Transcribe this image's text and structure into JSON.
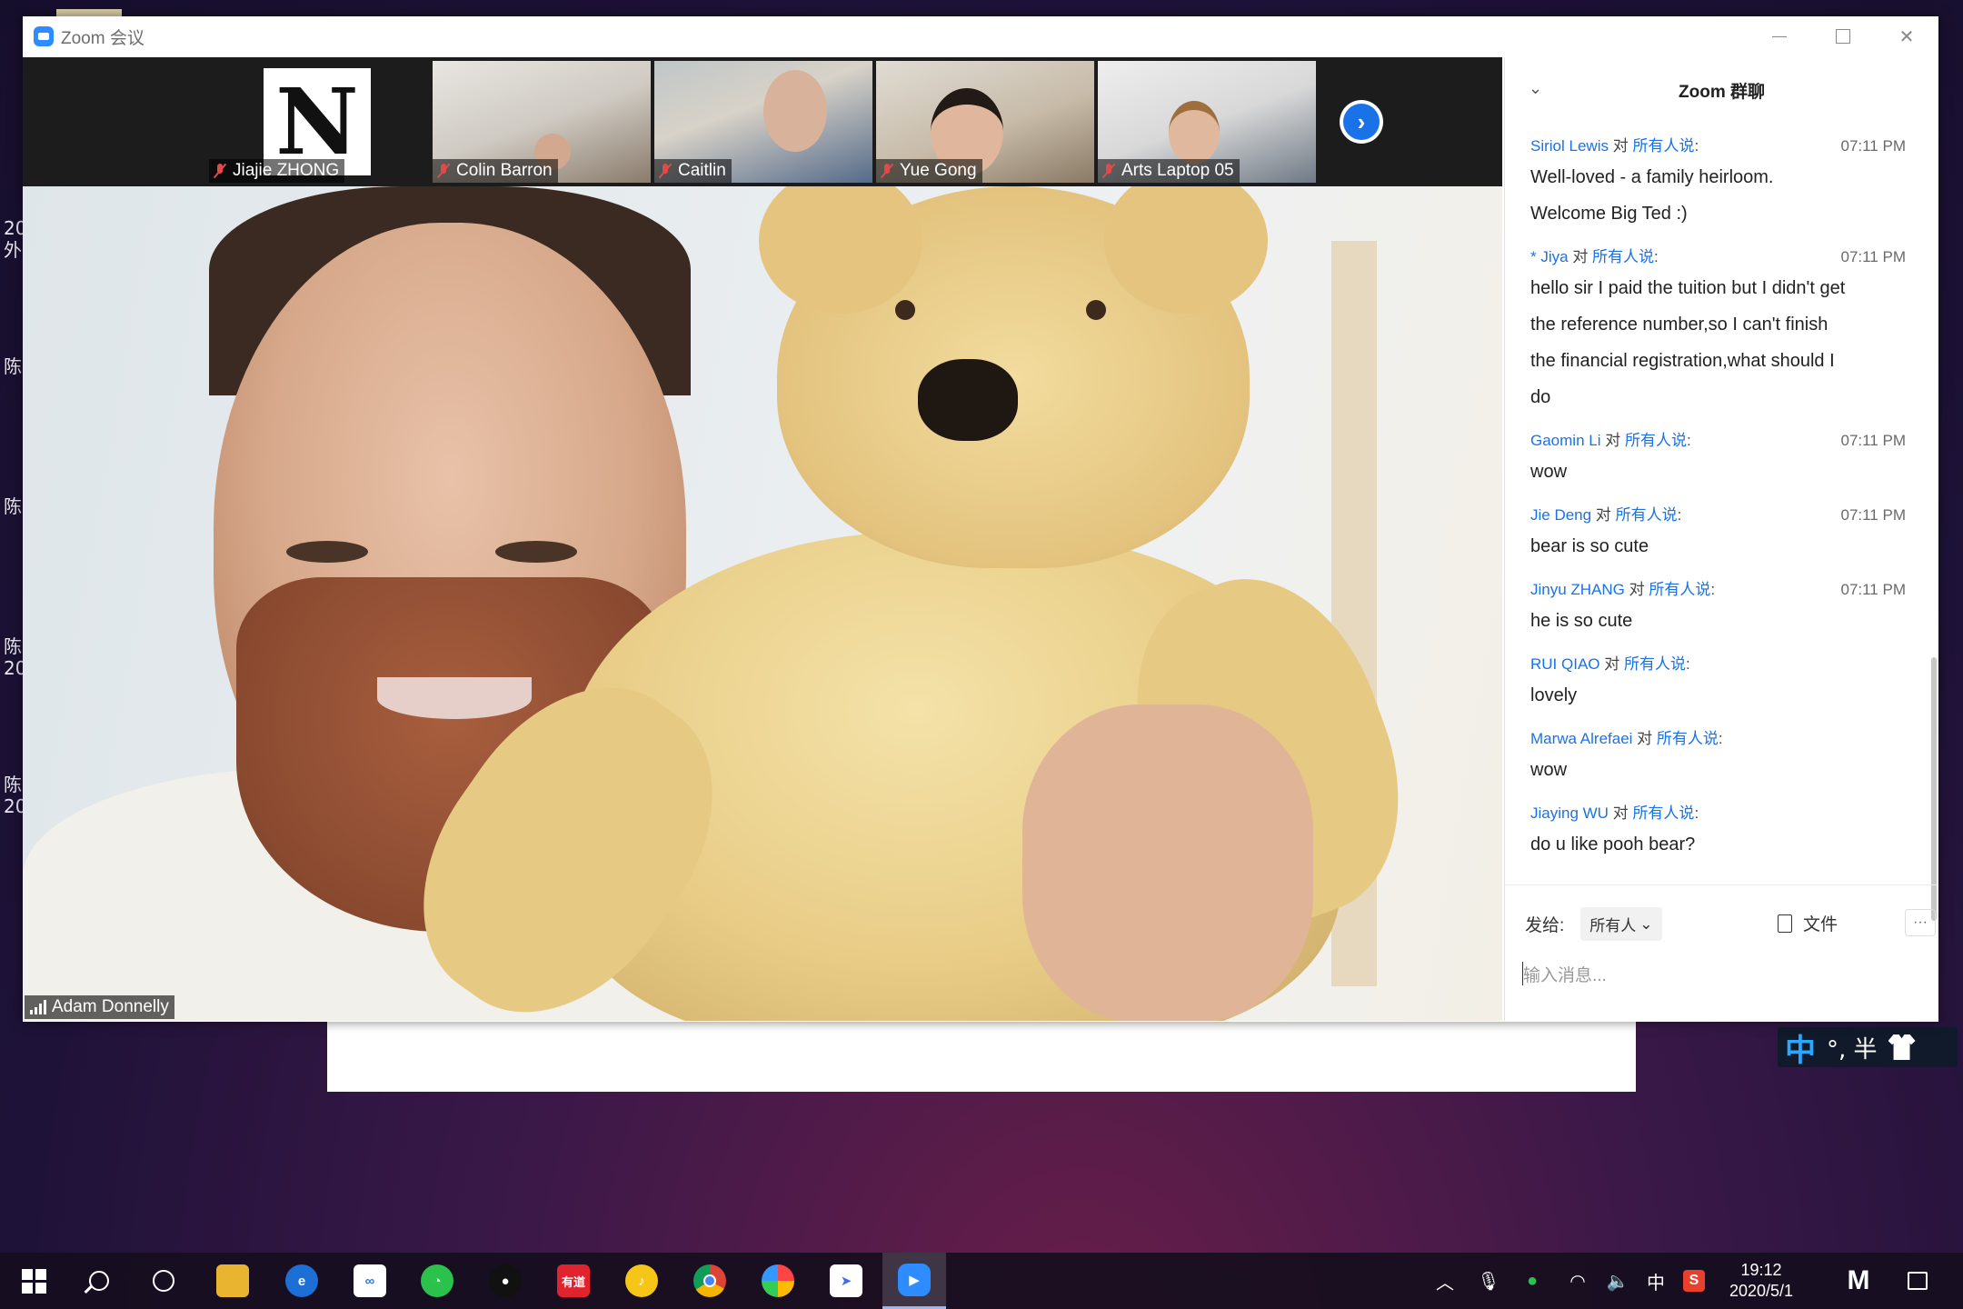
{
  "window": {
    "title": "Zoom 会议"
  },
  "desktop": {
    "side_glyphs": [
      "20",
      "外",
      "陈",
      "陈",
      "陈",
      "20",
      "陈",
      "20"
    ]
  },
  "participants": [
    {
      "name": "Jiajie ZHONG",
      "muted": true
    },
    {
      "name": "Colin Barron",
      "muted": true
    },
    {
      "name": "Caitlin",
      "muted": true
    },
    {
      "name": "Yue Gong",
      "muted": true
    },
    {
      "name": "Arts Laptop 05",
      "muted": true
    }
  ],
  "logo_tile_letter": "N",
  "active_speaker": {
    "name": "Adam Donnelly"
  },
  "chat": {
    "title": "Zoom 群聊",
    "to_word": "对",
    "target": "所有人说",
    "colon": ":",
    "messages": [
      {
        "sender": "Siriol Lewis",
        "time": "07:11 PM",
        "lines": [
          "Well-loved - a family heirloom.",
          "Welcome Big Ted :)"
        ]
      },
      {
        "sender": "* Jiya",
        "time": "07:11 PM",
        "lines": [
          "hello sir I paid the tuition but I didn't get",
          "the reference number,so I can't finish",
          "the financial registration,what should I",
          "do"
        ]
      },
      {
        "sender": "Gaomin Li",
        "time": "07:11 PM",
        "lines": [
          "wow"
        ]
      },
      {
        "sender": "Jie Deng",
        "time": "07:11 PM",
        "lines": [
          "bear is so cute"
        ]
      },
      {
        "sender": "Jinyu ZHANG",
        "time": "07:11 PM",
        "lines": [
          "he is so cute"
        ]
      },
      {
        "sender": "RUI QIAO",
        "time": "",
        "lines": [
          "lovely"
        ]
      },
      {
        "sender": "Marwa Alrefaei",
        "time": "",
        "lines": [
          "wow"
        ]
      },
      {
        "sender": "Jiaying WU",
        "time": "",
        "lines": [
          "do u like pooh bear?"
        ]
      }
    ],
    "send_to_label": "发给:",
    "send_to_value": "所有人",
    "file_label": "文件",
    "more_label": "···",
    "input_placeholder": "输入消息..."
  },
  "ime": {
    "mode": "中",
    "symbols": "°, 半"
  },
  "taskbar": {
    "apps": [
      "windows-start",
      "search",
      "cortana",
      "file-explorer",
      "edge",
      "baidu-netdisk",
      "wechat",
      "qq",
      "youdao",
      "qq-music",
      "chrome",
      "photo-app",
      "feishu",
      "zoom"
    ],
    "youdao_label": "有道",
    "tray_ime": "中",
    "time": "19:12",
    "date": "2020/5/1",
    "active_app": "zoom"
  }
}
